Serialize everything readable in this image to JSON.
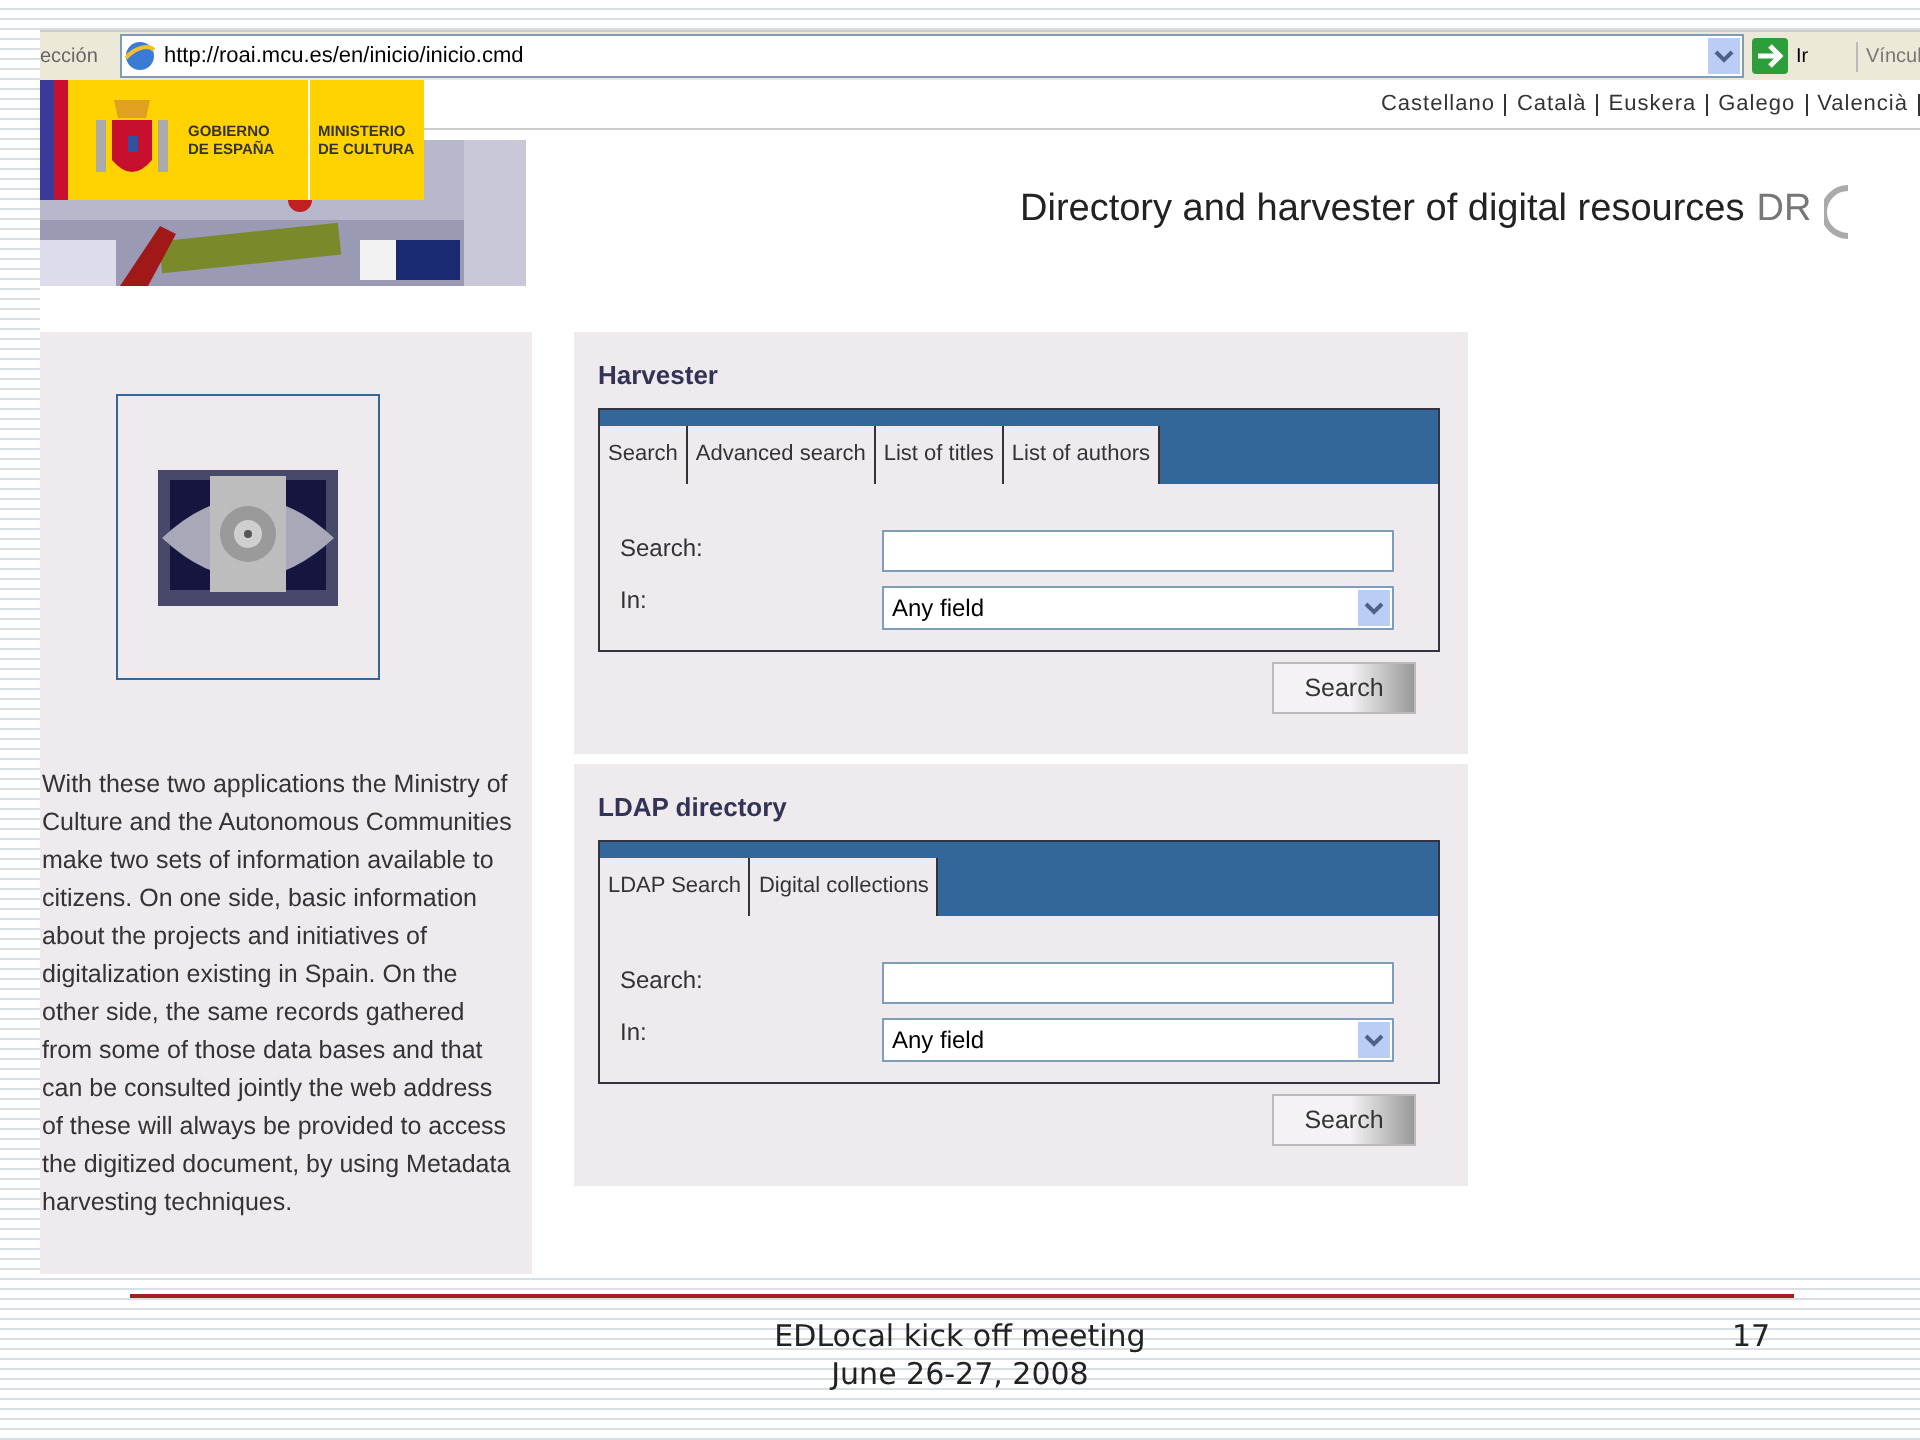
{
  "browser": {
    "address_label": "ección",
    "url": "http://roai.mcu.es/en/inicio/inicio.cmd",
    "go_label": "Ir",
    "links_label": "Víncul"
  },
  "header": {
    "logo": {
      "line_1": "GOBIERNO",
      "line_2": "DE ESPAÑA",
      "line_3": "MINISTERIO",
      "line_4": "DE CULTURA"
    },
    "languages": [
      "Castellano",
      "Català",
      "Euskera",
      "Galego",
      "Valencià"
    ],
    "title": "Directory and harvester of digital resources",
    "title_mark": "DR"
  },
  "intro": "With these two applications the Ministry of Culture and the Autonomous Communities make two sets of information available to citizens. On one side, basic information about the projects and initiatives of digitalization existing in Spain. On the other side, the same records gathered from some of those data bases and that can be consulted jointly the web address of these will always be provided to access the digitized document, by using Metadata harvesting techniques.",
  "panels": [
    {
      "title": "Harvester",
      "tabs": [
        "Search",
        "Advanced search",
        "List of titles",
        "List of authors"
      ],
      "search_label": "Search:",
      "in_label": "In:",
      "in_value": "Any field",
      "button": "Search"
    },
    {
      "title": "LDAP directory",
      "tabs": [
        "LDAP Search",
        "Digital collections"
      ],
      "search_label": "Search:",
      "in_label": "In:",
      "in_value": "Any field",
      "button": "Search"
    }
  ],
  "footer": {
    "event": "EDLocal kick off meeting",
    "date": "June 26-27, 2008",
    "page": "17"
  }
}
